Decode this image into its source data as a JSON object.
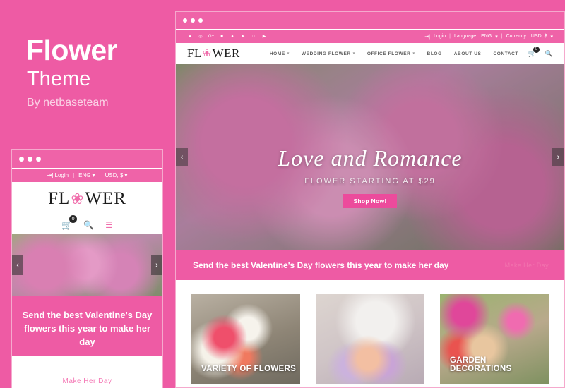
{
  "promo": {
    "title": "Flower",
    "subtitle": "Theme",
    "byline": "By netbaseteam",
    "background_color": "#ee5ba4"
  },
  "mobile_preview": {
    "window_dots": 3,
    "topbar": {
      "login": "Login",
      "login_icon": "sign-in-icon",
      "language": "ENG",
      "currency": "USD, $",
      "separator": "|"
    },
    "logo": {
      "prefix": "FL",
      "ornament": "flower-mark",
      "suffix": "WER"
    },
    "icons": {
      "cart": "cart-icon",
      "cart_badge": "0",
      "search": "search-icon",
      "menu": "hamburger-icon"
    },
    "slider": {
      "prev": "‹",
      "next": "›"
    },
    "band_text": "Send the best Valentine's Day flowers this year to make her day",
    "ghost_text": "Make Her Day"
  },
  "desktop_preview": {
    "window_dots": 3,
    "topbar": {
      "socials": [
        {
          "name": "facebook-icon",
          "glyph": "f"
        },
        {
          "name": "instagram-icon",
          "glyph": "◎"
        },
        {
          "name": "google-plus-icon",
          "glyph": "G+"
        },
        {
          "name": "linkedin-icon",
          "glyph": "in"
        },
        {
          "name": "pinterest-icon",
          "glyph": "P"
        },
        {
          "name": "twitter-icon",
          "glyph": "✒"
        },
        {
          "name": "tumblr-icon",
          "glyph": "t"
        },
        {
          "name": "youtube-icon",
          "glyph": "▶"
        }
      ],
      "login": "Login",
      "login_icon": "sign-in-icon",
      "language_label": "Language:",
      "language_value": "ENG",
      "currency_label": "Currency:",
      "currency_value": "USD, $",
      "separator": "|"
    },
    "logo": {
      "prefix": "FL",
      "ornament": "flower-mark",
      "suffix": "WER"
    },
    "menu": [
      {
        "label": "HOME",
        "caret": true
      },
      {
        "label": "WEDDING FLOWER",
        "caret": true
      },
      {
        "label": "OFFICE FLOWER",
        "caret": true
      },
      {
        "label": "BLOG",
        "caret": false
      },
      {
        "label": "ABOUT US",
        "caret": false
      },
      {
        "label": "CONTACT",
        "caret": false
      }
    ],
    "nav_icons": {
      "cart": "cart-icon",
      "cart_badge": "0",
      "search": "search-icon"
    },
    "hero": {
      "headline": "Love and Romance",
      "subline": "FLOWER STARTING AT $29",
      "button": "Shop Now!",
      "prev": "‹",
      "next": "›"
    },
    "band_text": "Send the best Valentine's Day flowers this year to make her day",
    "band_ghost": "Make Her Day",
    "cards": [
      {
        "label": "VARIETY OF FLOWERS"
      },
      {
        "label": ""
      },
      {
        "label": "GARDEN DECORATIONS"
      }
    ]
  }
}
